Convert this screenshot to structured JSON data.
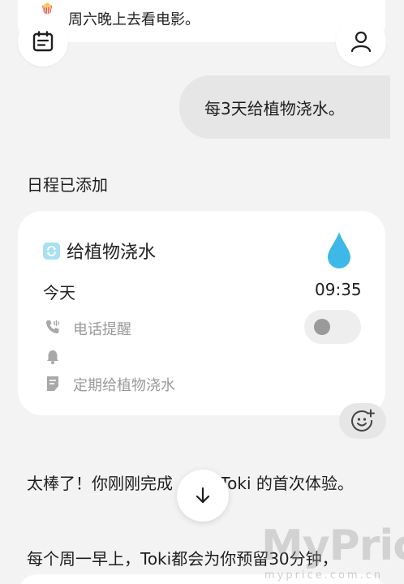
{
  "top_message": {
    "icon": "popcorn-icon",
    "text": "周六晚上去看电影。"
  },
  "header": {
    "calendar_icon": "calendar-note-icon",
    "profile_icon": "user-icon"
  },
  "user_message": "每3天给植物浇水。",
  "schedule_added_label": "日程已添加",
  "task_card": {
    "title": "给植物浇水",
    "title_icon": "repeat-icon",
    "accent_icon": "water-drop-icon",
    "accent_color": "#3db8e8",
    "date": "今天",
    "time": "09:35",
    "phone_reminder_label": "电话提醒",
    "phone_reminder_enabled": false,
    "alarm_icon": "bell-icon",
    "note": "定期给植物浇水"
  },
  "reaction_button_icon": "smiley-plus-icon",
  "assistant_messages": [
    {
      "before": "太棒了！你刚刚完成",
      "after": " Toki 的首次体验。"
    },
    {
      "text": "每个周一早上，Toki都会为你预留30分钟，"
    }
  ],
  "scroll_down_icon": "arrow-down-icon",
  "watermark": {
    "main": "MyPrice",
    "sub": "myprice.com.cn"
  }
}
